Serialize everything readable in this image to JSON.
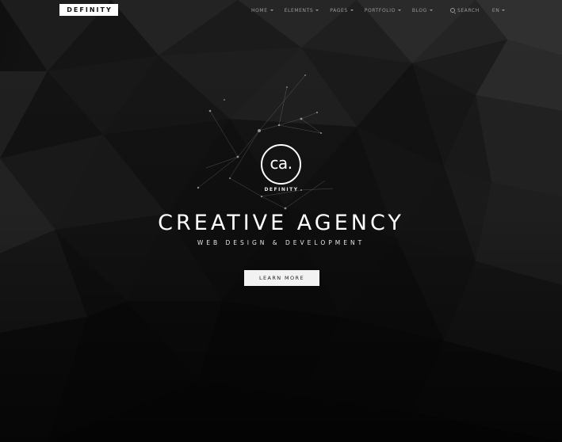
{
  "brand": {
    "logo_text": "DEFINITY"
  },
  "nav": {
    "items": [
      {
        "label": "HOME",
        "has_caret": true
      },
      {
        "label": "ELEMENTS",
        "has_caret": true
      },
      {
        "label": "PAGES",
        "has_caret": true
      },
      {
        "label": "PORTFOLIO",
        "has_caret": true
      },
      {
        "label": "BLOG",
        "has_caret": true
      }
    ],
    "search_label": "SEARCH",
    "search_icon": "search-icon",
    "language": "EN"
  },
  "hero": {
    "emblem_text": "ca.",
    "emblem_caption": "DEFINITY",
    "title": "CREATIVE AGENCY",
    "subtitle": "WEB DESIGN & DEVELOPMENT",
    "cta_label": "LEARN MORE"
  },
  "colors": {
    "background": "#0c0c0c",
    "text": "#ffffff",
    "nav_text": "#9a9a9a",
    "button_bg": "#f2f2f2",
    "button_text": "#222222"
  }
}
